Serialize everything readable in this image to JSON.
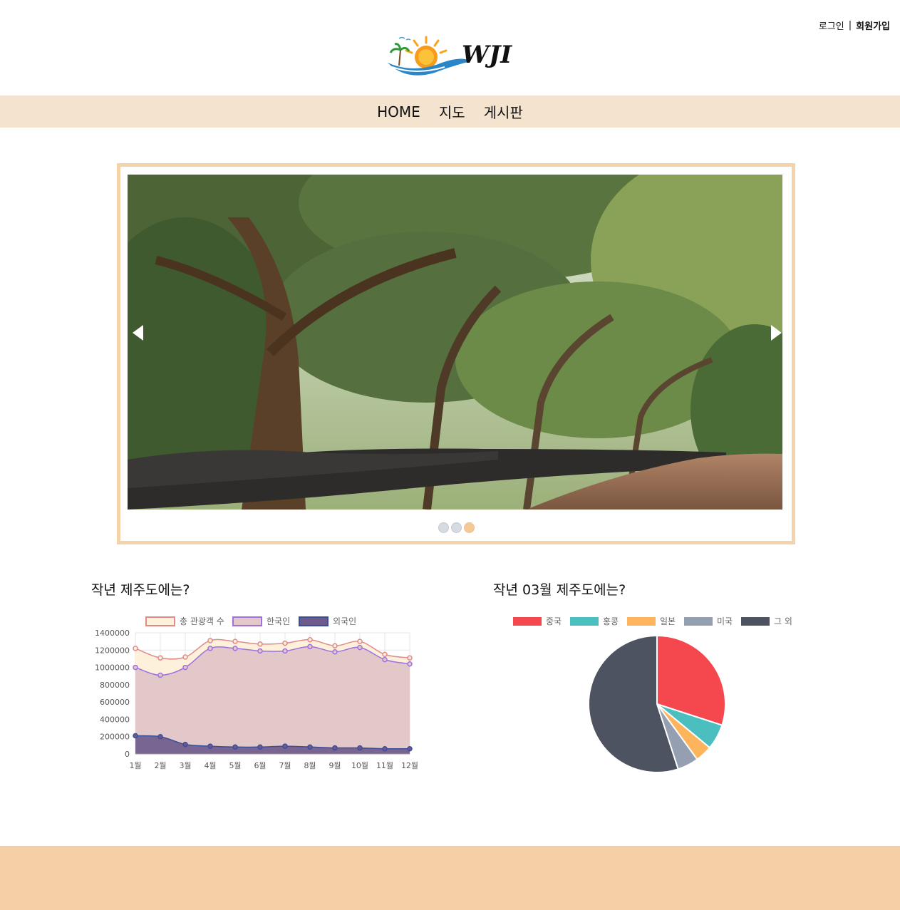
{
  "header": {
    "login_label": "로그인",
    "signup_label": "회원가입",
    "separator": "|",
    "logo_text": "WJI"
  },
  "nav": {
    "items": [
      {
        "label": "HOME"
      },
      {
        "label": "지도"
      },
      {
        "label": "게시판"
      }
    ]
  },
  "slider": {
    "image_icon": "forest-path-photo",
    "total_slides": 3,
    "active_slide": 3
  },
  "sections": {
    "left_title": "작년 제주도에는?",
    "right_title": "작년 03월 제주도에는?"
  },
  "colors": {
    "nav_bg": "#f4e3cf",
    "frame_border": "#f4d2aa",
    "footer_bg": "#f5cfa6"
  },
  "chart_data": [
    {
      "type": "area",
      "categories": [
        "1월",
        "2월",
        "3월",
        "4월",
        "5월",
        "6월",
        "7월",
        "8월",
        "9월",
        "10월",
        "11월",
        "12월"
      ],
      "series": [
        {
          "name": "총 관광객 수",
          "color": "#e08a8a",
          "fill": "#fdf1dc",
          "values": [
            1220000,
            1110000,
            1120000,
            1310000,
            1300000,
            1270000,
            1280000,
            1320000,
            1250000,
            1300000,
            1150000,
            1110000
          ]
        },
        {
          "name": "한국인",
          "color": "#a070e0",
          "fill": "#e2c8c8",
          "values": [
            1000000,
            910000,
            1000000,
            1220000,
            1220000,
            1190000,
            1190000,
            1240000,
            1180000,
            1230000,
            1090000,
            1040000
          ]
        },
        {
          "name": "외국인",
          "color": "#3a4e9a",
          "fill": "#6e5a8c",
          "values": [
            210000,
            200000,
            110000,
            90000,
            80000,
            80000,
            90000,
            80000,
            70000,
            70000,
            60000,
            60000
          ]
        }
      ],
      "ylim": [
        0,
        1400000
      ],
      "yticks": [
        "0",
        "200000",
        "400000",
        "600000",
        "800000",
        "1000000",
        "1200000",
        "1400000"
      ],
      "grid": true,
      "legend": "top"
    },
    {
      "type": "pie",
      "labels": [
        "중국",
        "홍콩",
        "일본",
        "미국",
        "그 외"
      ],
      "values": [
        30,
        6,
        4,
        5,
        55
      ],
      "colors": [
        "#f5474e",
        "#4bbfbf",
        "#fdb45c",
        "#949fb1",
        "#4d5360"
      ],
      "legend": "top"
    }
  ]
}
